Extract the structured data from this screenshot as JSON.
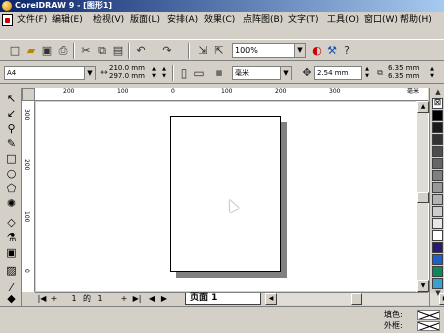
{
  "window": {
    "title": "CorelDRAW 9 - [图形1]"
  },
  "menu": [
    "文件(F)",
    "编辑(E)",
    "检视(V)",
    "版面(L)",
    "安排(A)",
    "效果(C)",
    "点阵图(B)",
    "文字(T)",
    "工具(O)",
    "窗口(W)",
    "帮助(H)"
  ],
  "standard_toolbar": {
    "icons": [
      "new-icon",
      "open-icon",
      "save-icon",
      "print-icon",
      "cut-icon",
      "copy-icon",
      "paste-icon",
      "undo-icon",
      "redo-icon",
      "import-icon",
      "export-icon"
    ],
    "zoom_value": "100%"
  },
  "property_bar": {
    "paper_size": "A4",
    "width": "210.0 mm",
    "height": "297.0 mm",
    "units": "毫米",
    "nudge": "2.54 mm",
    "dup_x": "6.35 mm",
    "dup_y": "6.35 mm"
  },
  "rulers": {
    "h_labels": [
      "200",
      "100",
      "0",
      "100",
      "200",
      "300"
    ],
    "v_labels": [
      "300",
      "200",
      "100",
      "0"
    ],
    "unit": "毫米"
  },
  "page_nav": {
    "current": "1",
    "separator": "的",
    "total": "1",
    "tab_label": "页面 1"
  },
  "palette": {
    "colors": [
      "#ffffff",
      "#000000",
      "#1a1a1a",
      "#333333",
      "#4d4d4d",
      "#666666",
      "#808080",
      "#999999",
      "#b3b3b3",
      "#cccccc",
      "#e6e6e6",
      "#ffffff",
      "#2a1a6e",
      "#1f5fc8",
      "#0a8a5a",
      "#3aa0d0"
    ]
  },
  "status": {
    "fill_label": "填色:",
    "outline_label": "外框:"
  }
}
